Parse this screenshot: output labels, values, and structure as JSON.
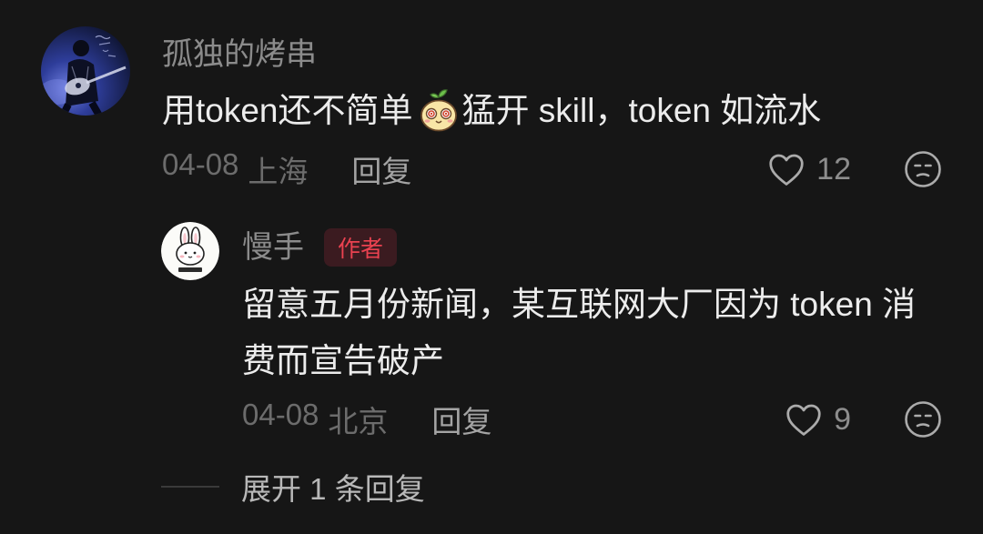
{
  "theme": {
    "background": "#161616",
    "text_primary": "#ececec",
    "username": "#8b8b8b",
    "meta": "#6c6c6c",
    "reply_label": "#a4a4a4",
    "like_count": "#8d8d8d",
    "icon": "#ababab",
    "author_badge_bg": "#3b1b20",
    "author_badge_text": "#ea4250",
    "expand_text": "#b8b8b8",
    "divider": "#3a3a3a"
  },
  "comment": {
    "avatar": "user-avatar-icon",
    "username": "孤独的烤串",
    "content": {
      "before_emoji": "用token还不简单",
      "emoji": "cute-face-emoji-icon",
      "after_emoji": "猛开 skill，token 如流水"
    },
    "date": "04-08",
    "location": "上海",
    "reply_label": "回复",
    "like_icon": "heart-outline-icon",
    "like_count": 12,
    "dislike_icon": "dislike-face-icon"
  },
  "reply": {
    "avatar": "user-avatar-icon",
    "username": "慢手",
    "badge": "作者",
    "content": "留意五月份新闻，某互联网大厂因为 token 消费而宣告破产",
    "date": "04-08",
    "location": "北京",
    "reply_label": "回复",
    "like_icon": "heart-outline-icon",
    "like_count": 9,
    "dislike_icon": "dislike-face-icon"
  },
  "expand_replies": {
    "label": "展开 1 条回复"
  }
}
